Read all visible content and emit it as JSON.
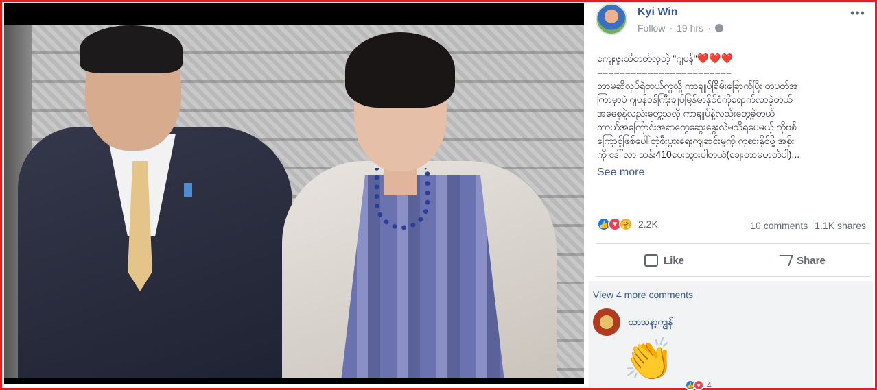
{
  "post": {
    "author": "Kyi Win",
    "follow_label": "Follow",
    "separator": "·",
    "time": "19 hrs",
    "separator2": "·",
    "more_label": "•••",
    "text_lines": [
      "ကျေးဇူးသိတတ်လှတဲ့ \"ဂျပန်\"",
      "========================",
      "ဘာမဆိုလုပ်ရဲတယ်ကွလို့ ကာချုပ်ခြိမ်းခြောက်ပြီး တပတ်အ",
      "ကြာမှာပဲ ဂျပန်ဝန်ကြီးချုပ်မြန်မာနိုင်ငံကိုရောက်လာခဲ့တယ်",
      "အဓေစုနဲ့လည်းတွေ့သလို ကာချုပ်နဲ့လည်းတွေ့ခဲ့တယ်",
      "ဘာယ်အကြောင်းအရာတွေဆွေးနွေးလဲမသိရပေမယ့် ကိုဗစ်",
      "ကြောင့်ဖြစ်ပေါ်တဲ့စီးပွားရေးကျဆင်းမှုကို ကုစားနိုင်ဖို့ အစိုး",
      "ကို ဒေါ်လာ သန်း410ပေးသွားပါတယ်(ချေးတာမဟုတ်ပါ)..."
    ],
    "hearts": "❤️❤️❤️",
    "see_more": "See more",
    "reaction_count": "2.2K",
    "comments_count": "10 comments",
    "shares_count": "1.1K shares",
    "like_label": "Like",
    "share_label": "Share"
  },
  "comments": {
    "view_more": "View 4 more comments",
    "commenter_name": "သာသနာ့ကျွန်",
    "sticker": "👏",
    "mini_reaction_count": "4"
  },
  "colors": {
    "frame": "#e02020",
    "link": "#385898",
    "muted": "#606770"
  }
}
